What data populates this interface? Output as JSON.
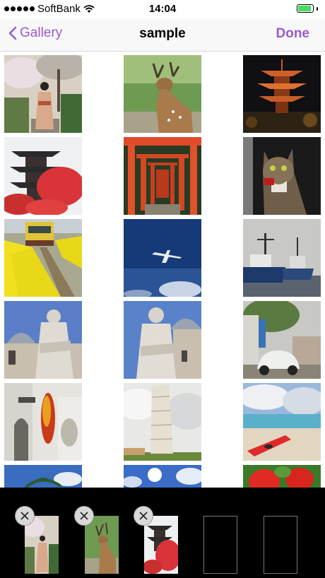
{
  "status_bar": {
    "carrier": "SoftBank",
    "time": "14:04",
    "signal_bars": 5,
    "battery_level": 0.8
  },
  "nav": {
    "back_label": "Gallery",
    "title": "sample",
    "done_label": "Done"
  },
  "colors": {
    "accent": "#9b59d0",
    "battery": "#4cd964"
  },
  "thumbnails": [
    {
      "icon": "kimono-woman-photo"
    },
    {
      "icon": "deer-photo"
    },
    {
      "icon": "night-pagoda-photo"
    },
    {
      "icon": "pagoda-maple-photo"
    },
    {
      "icon": "torii-gates-photo"
    },
    {
      "icon": "cat-photo"
    },
    {
      "icon": "train-rapeseed-photo"
    },
    {
      "icon": "airplane-sky-photo"
    },
    {
      "icon": "fishing-boats-photo"
    },
    {
      "icon": "statue-dome-photo"
    },
    {
      "icon": "statue-dome-photo-2"
    },
    {
      "icon": "vintage-car-photo"
    },
    {
      "icon": "alley-peppers-photo"
    },
    {
      "icon": "leaning-tower-photo"
    },
    {
      "icon": "beach-kayak-photo"
    },
    {
      "icon": "palm-sky-photo"
    },
    {
      "icon": "sun-sky-photo"
    },
    {
      "icon": "red-flowers-photo"
    }
  ],
  "selected": [
    {
      "icon": "kimono-woman-photo"
    },
    {
      "icon": "deer-photo"
    },
    {
      "icon": "pagoda-maple-photo"
    }
  ],
  "empty_slots": 2
}
